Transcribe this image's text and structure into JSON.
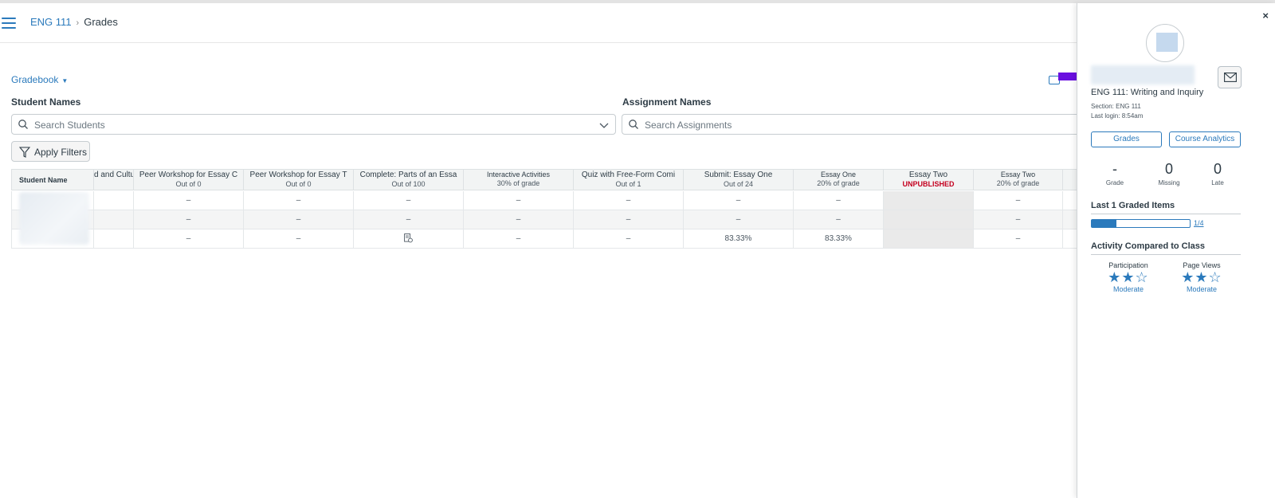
{
  "breadcrumb": {
    "course": "ENG 111",
    "current": "Grades"
  },
  "gradebook_menu": "Gradebook",
  "filters": {
    "student_label": "Student Names",
    "student_placeholder": "Search Students",
    "assignment_label": "Assignment Names",
    "assignment_placeholder": "Search Assignments",
    "apply_label": "Apply Filters"
  },
  "grid": {
    "student_header": "Student Name",
    "columns": [
      {
        "title": "d and Cultu",
        "sub": ""
      },
      {
        "title": "Peer Workshop for Essay C",
        "sub": "Out of 0"
      },
      {
        "title": "Peer Workshop for Essay T",
        "sub": "Out of 0"
      },
      {
        "title": "Complete: Parts of an Essa",
        "sub": "Out of 100"
      },
      {
        "title": "Interactive Activities",
        "sub": "30% of grade"
      },
      {
        "title": "Quiz with Free-Form Comi",
        "sub": "Out of 1"
      },
      {
        "title": "Submit: Essay One",
        "sub": "Out of 24"
      },
      {
        "title": "Essay One",
        "sub": "20% of grade"
      },
      {
        "title": "Essay Two",
        "sub": "UNPUBLISHED"
      },
      {
        "title": "Essay Two",
        "sub": "20% of grade"
      }
    ],
    "rows": [
      [
        "",
        "–",
        "–",
        "–",
        "–",
        "–",
        "–",
        "–",
        "",
        "–"
      ],
      [
        "",
        "–",
        "–",
        "–",
        "–",
        "–",
        "–",
        "–",
        "",
        "–"
      ],
      [
        "",
        "–",
        "–",
        "",
        "–",
        "–",
        "83.33%",
        "83.33%",
        "",
        "–"
      ]
    ]
  },
  "tray": {
    "close": "×",
    "course": "ENG 111: Writing and Inquiry",
    "section": "Section: ENG 111",
    "last_login": "Last login: 8:54am",
    "grades_button": "Grades",
    "analytics_button": "Course Analytics",
    "stats": [
      {
        "value": "-",
        "label": "Grade"
      },
      {
        "value": "0",
        "label": "Missing"
      },
      {
        "value": "0",
        "label": "Late"
      }
    ],
    "graded_title": "Last 1 Graded Items",
    "graded_fraction": "1/4",
    "graded_progress": 0.25,
    "activity_title": "Activity Compared to Class",
    "activity": [
      {
        "label": "Participation",
        "stars": "★★☆",
        "level": "Moderate"
      },
      {
        "label": "Page Views",
        "stars": "★★☆",
        "level": "Moderate"
      }
    ]
  },
  "colors": {
    "link": "#2b7abc",
    "arrow": "#6a0fe0",
    "unpublished": "#c4001f"
  },
  "icons": [
    "hamburger-icon",
    "search-icon",
    "chevron-down-icon",
    "filter-icon",
    "mail-icon",
    "close-icon",
    "submission-icon"
  ]
}
